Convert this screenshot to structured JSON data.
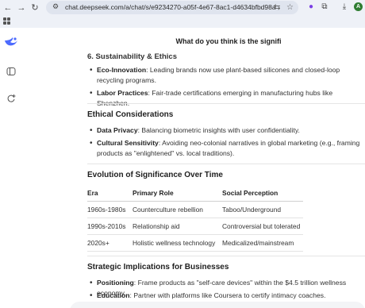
{
  "browser": {
    "url": "chat.deepseek.com/a/chat/s/e9234270-a05f-4e67-8ac1-d4634bfbd98a",
    "profile_initial": "A"
  },
  "chat": {
    "title": "What do you think is the signifi"
  },
  "sections": {
    "sustainability": {
      "heading": "6. Sustainability & Ethics",
      "items": [
        {
          "label": "Eco-Innovation",
          "text": ": Leading brands now use plant-based silicones and closed-loop recycling programs."
        },
        {
          "label": "Labor Practices",
          "text": ": Fair-trade certifications emerging in manufacturing hubs like Shenzhen."
        }
      ]
    },
    "ethics": {
      "heading": "Ethical Considerations",
      "items": [
        {
          "label": "Data Privacy",
          "text": ": Balancing biometric insights with user confidentiality."
        },
        {
          "label": "Cultural Sensitivity",
          "text": ": Avoiding neo-colonial narratives in global marketing (e.g., framing products as \"enlightened\" vs. local traditions)."
        }
      ]
    },
    "evolution": {
      "heading": "Evolution of Significance Over Time",
      "columns": [
        "Era",
        "Primary Role",
        "Social Perception"
      ],
      "rows": [
        [
          "1960s-1980s",
          "Counterculture rebellion",
          "Taboo/Underground"
        ],
        [
          "1990s-2010s",
          "Relationship aid",
          "Controversial but tolerated"
        ],
        [
          "2020s+",
          "Holistic wellness technology",
          "Medicalized/mainstream"
        ]
      ]
    },
    "strategic": {
      "heading": "Strategic Implications for Businesses",
      "items": [
        {
          "label": "Positioning",
          "text": ": Frame products as \"self-care devices\" within the $4.5 trillion wellness economy."
        },
        {
          "label": "Education",
          "text": ": Partner with platforms like Coursera to certify intimacy coaches."
        }
      ]
    }
  }
}
